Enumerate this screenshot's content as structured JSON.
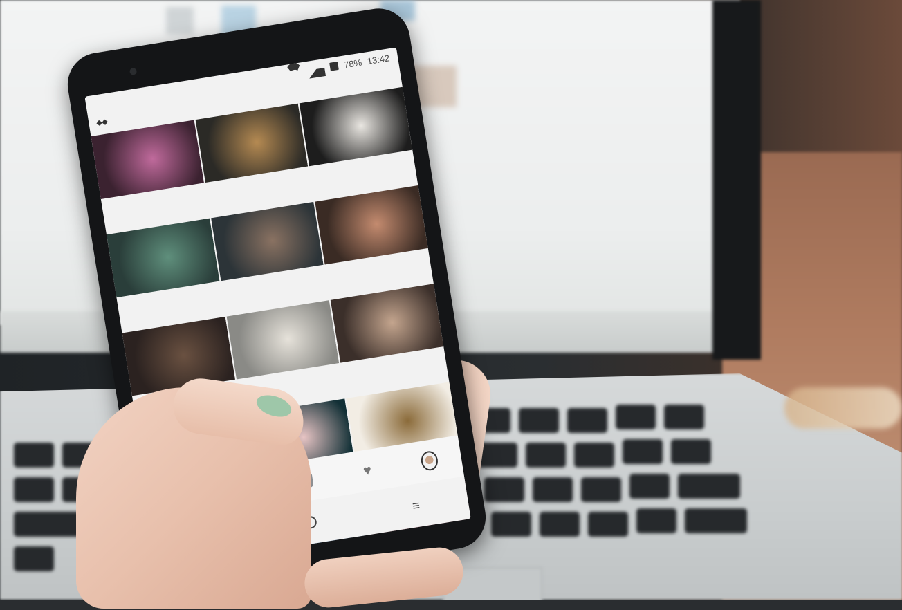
{
  "status_bar": {
    "battery": "78%",
    "time": "13:42"
  },
  "grid_rows": [
    {
      "tiles": [
        {
          "name": "pink-flowers-photo",
          "colors": [
            "#3b2230",
            "#c06a9c"
          ]
        },
        {
          "name": "sunset-landscape-photo",
          "colors": [
            "#2b2a26",
            "#b58a52"
          ]
        },
        {
          "name": "coffee-cup-photo",
          "colors": [
            "#1d1d1d",
            "#e9e6e1"
          ]
        }
      ]
    },
    {
      "tiles": [
        {
          "name": "succulent-photo",
          "colors": [
            "#2a3e3a",
            "#5f8f7c"
          ]
        },
        {
          "name": "latte-cup-photo",
          "colors": [
            "#2c3438",
            "#8a7262"
          ]
        },
        {
          "name": "hand-with-plant-photo",
          "colors": [
            "#3a2b24",
            "#c48b6f"
          ]
        }
      ]
    },
    {
      "tiles": [
        {
          "name": "potted-plant-photo",
          "colors": [
            "#2b2220",
            "#6a5141"
          ]
        },
        {
          "name": "interior-room-photo",
          "colors": [
            "#8a8a86",
            "#e6e2da"
          ]
        },
        {
          "name": "man-on-sofa-photo",
          "colors": [
            "#3b2f2a",
            "#c4a58e"
          ]
        }
      ]
    },
    {
      "tiles": [
        {
          "name": "autumn-leaves-photo",
          "colors": [
            "#5a4638",
            "#d3a560"
          ]
        },
        {
          "name": "blue-bokeh-photo",
          "colors": [
            "#123036",
            "#e7c4c4"
          ]
        },
        {
          "name": "pineapple-photo",
          "colors": [
            "#f2ede4",
            "#8b6b3a"
          ]
        }
      ]
    },
    {
      "tiles": [
        {
          "name": "blue-flowers-photo",
          "colors": [
            "#0f2e44",
            "#3f7fa5"
          ]
        },
        {
          "name": "night-wave-photo",
          "colors": [
            "#233a56",
            "#4b79a8"
          ]
        },
        {
          "name": "pink-sky-photo",
          "colors": [
            "#44242b",
            "#d0707f"
          ]
        }
      ]
    }
  ],
  "bottom_nav": [
    {
      "name": "home-icon"
    },
    {
      "name": "search-icon",
      "glyph": "⌕"
    },
    {
      "name": "add-post-icon",
      "glyph": "+"
    },
    {
      "name": "heart-icon",
      "glyph": "♥"
    },
    {
      "name": "profile-avatar-icon"
    }
  ],
  "system_nav": [
    {
      "name": "back-icon",
      "glyph": "‹"
    },
    {
      "name": "home-button-icon"
    },
    {
      "name": "recents-icon",
      "glyph": "≡"
    }
  ]
}
